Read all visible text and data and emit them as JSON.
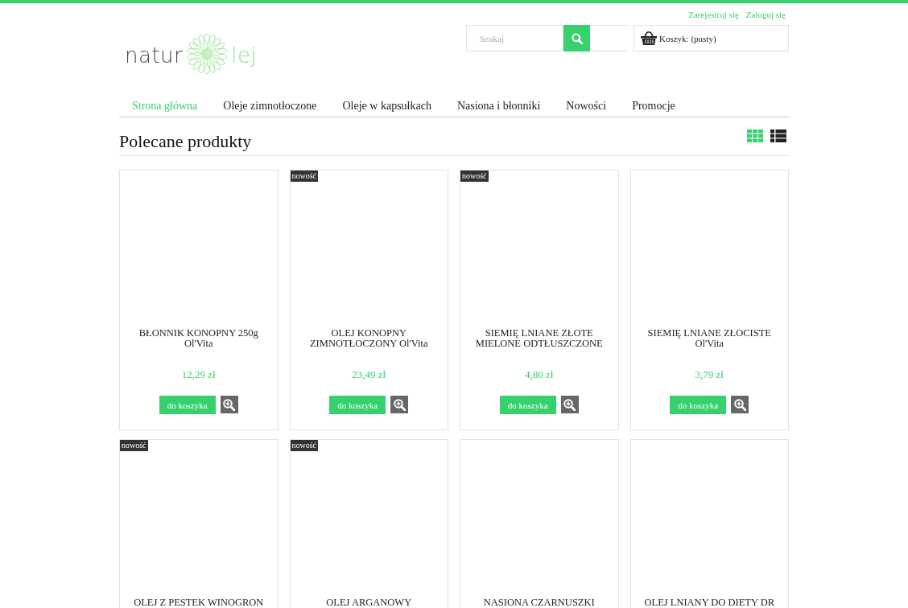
{
  "top_links": [
    {
      "label": "Zarejestruj się"
    },
    {
      "label": "Zaloguj się"
    }
  ],
  "logo": {
    "text_dark": "natur",
    "text_light": "lej"
  },
  "search": {
    "placeholder": "Szukaj"
  },
  "cart": {
    "label": "Koszyk: (pusty)"
  },
  "nav": [
    {
      "label": "Strona główna",
      "selected": true
    },
    {
      "label": "Oleje zimnotłoczone",
      "selected": false
    },
    {
      "label": "Oleje w kapsułkach",
      "selected": false
    },
    {
      "label": "Nasiona i błonniki",
      "selected": false
    },
    {
      "label": "Nowości",
      "selected": false
    },
    {
      "label": "Promocje",
      "selected": false
    }
  ],
  "section": {
    "title": "Polecane produkty",
    "views": [
      {
        "kind": "grid",
        "selected": true
      },
      {
        "kind": "list",
        "selected": false
      }
    ]
  },
  "products": [
    {
      "name": "BŁONNIK KONOPNY 250g Ol'Vita",
      "price": "12,29 zł",
      "button": "do koszyka"
    },
    {
      "badge": "nowość",
      "name": "OLEJ KONOPNY ZIMNOTŁOCZONY Ol'Vita",
      "price": "23,49 zł",
      "button": "do koszyka"
    },
    {
      "badge": "nowość",
      "name": "SIEMIĘ LNIANE ZŁOTE MIELONE ODTŁUSZCZONE",
      "price": "4,80 zł",
      "button": "do koszyka"
    },
    {
      "name": "SIEMIĘ LNIANE ZŁOCISTE Ol'Vita",
      "price": "3,79 zł",
      "button": "do koszyka"
    },
    {
      "badge": "nowość",
      "name": "OLEJ Z PESTEK WINOGRON"
    },
    {
      "badge": "nowość",
      "name": "OLEJ ARGANOWY"
    },
    {
      "name": "NASIONA CZARNUSZKI"
    },
    {
      "name": "OLEJ LNIANY DO DIETY DR"
    }
  ]
}
